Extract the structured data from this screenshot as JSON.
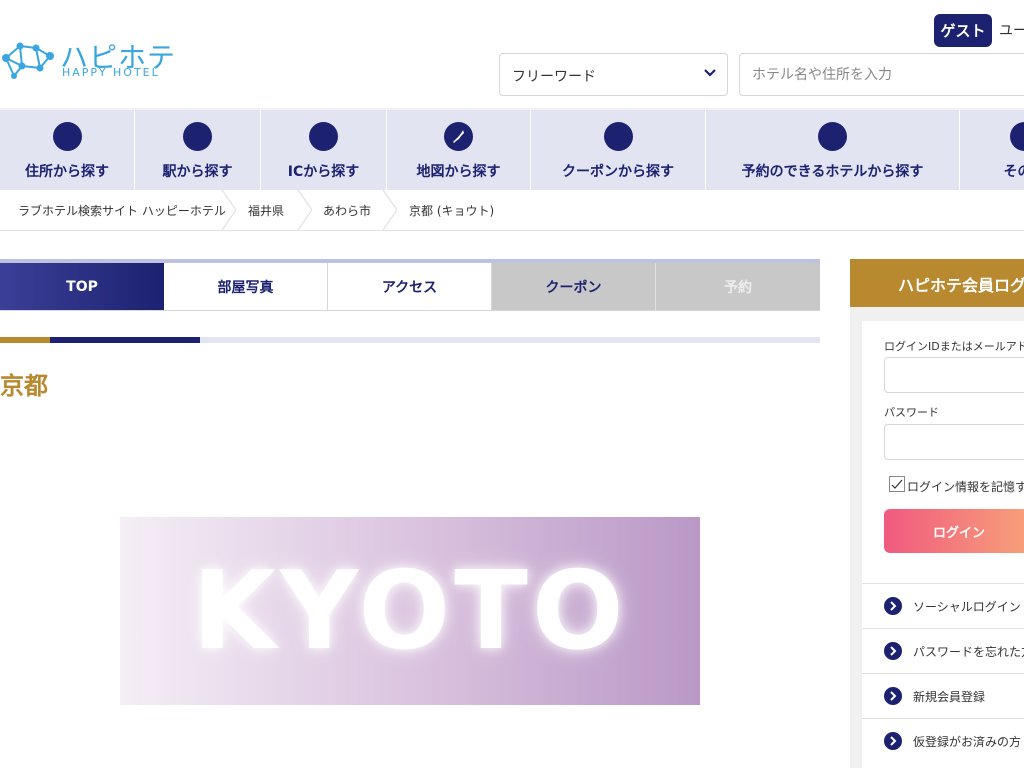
{
  "header": {
    "logo_text_jp": "ハピホテ",
    "logo_text_en": "HAPPY HOTEL",
    "guest_label": "ゲスト",
    "user_label": "ユー",
    "search_type": {
      "selected": "フリーワード"
    },
    "search_input_placeholder": "ホテル名や住所を入力"
  },
  "nav": {
    "items": [
      {
        "label": "住所から探す"
      },
      {
        "label": "駅から探す"
      },
      {
        "label": "ICから探す"
      },
      {
        "label": "地図から探す"
      },
      {
        "label": "クーポンから探す"
      },
      {
        "label": "予約のできるホテルから探す"
      },
      {
        "label": "その他"
      }
    ]
  },
  "breadcrumb": [
    "ラブホテル検索サイト ハッピーホテル",
    "福井県",
    "あわら市",
    "京都 (キョウト)"
  ],
  "tabs": [
    {
      "label": "TOP"
    },
    {
      "label": "部屋写真"
    },
    {
      "label": "アクセス"
    },
    {
      "label": "クーポン"
    },
    {
      "label": "予約"
    }
  ],
  "hotel": {
    "name": "京都",
    "image_text": "KYOTO"
  },
  "login": {
    "title": "ハピホテ会員ログ",
    "id_label": "ログインIDまたはメールアドレ",
    "password_label": "パスワード",
    "remember_label": "ログイン情報を記憶す",
    "button_label": "ログイン",
    "links": [
      {
        "label": "ソーシャルログイン"
      },
      {
        "label": "パスワードを忘れた方"
      },
      {
        "label": "新規会員登録"
      },
      {
        "label": "仮登録がお済みの方"
      }
    ]
  },
  "colors": {
    "navy": "#1c2270",
    "gold": "#b8892f",
    "nav_bg": "#e3e4f2",
    "logo_blue": "#3aa6df",
    "login_gradient_start": "#f05a7e",
    "login_gradient_end": "#f8a37a"
  }
}
